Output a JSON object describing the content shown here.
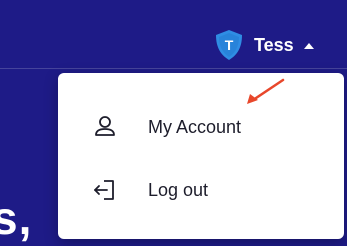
{
  "header": {
    "user_name": "Tess",
    "avatar_letter": "T",
    "caret_icon": "caret-up-icon"
  },
  "background_heading": {
    "text": "s,"
  },
  "dropdown_menu": {
    "items": [
      {
        "label": "My Account",
        "icon": "user-icon"
      },
      {
        "label": "Log out",
        "icon": "log-out-icon"
      }
    ]
  },
  "annotation": {
    "icon": "red-arrow-icon",
    "color": "#e8472b"
  },
  "colors": {
    "header_bg": "#1e1b87",
    "avatar_shield": "#2f8de4",
    "menu_bg": "#ffffff",
    "menu_text": "#1d1d2b"
  }
}
